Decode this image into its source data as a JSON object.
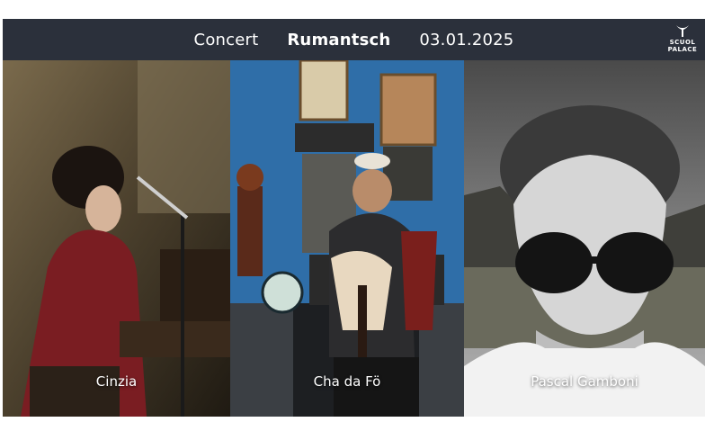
{
  "header": {
    "left": "Concert",
    "center": "Rumantsch",
    "right": "03.01.2025",
    "logo_line1": "SCUOL",
    "logo_line2": "PALACE"
  },
  "panels": [
    {
      "caption": "Cinzia"
    },
    {
      "caption": "Cha da Fö"
    },
    {
      "caption": "Pascal Gamboni"
    }
  ],
  "colors": {
    "header_bg": "#2b303b",
    "header_text": "#ffffff"
  }
}
